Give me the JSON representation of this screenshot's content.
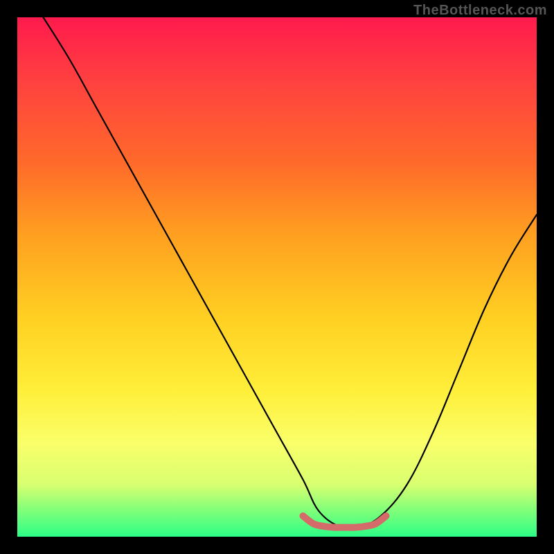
{
  "watermark": "TheBottleneck.com",
  "colors": {
    "frame": "#000000",
    "gradient_stops": [
      {
        "pct": 0,
        "color": "#ff1a4d"
      },
      {
        "pct": 12,
        "color": "#ff4040"
      },
      {
        "pct": 28,
        "color": "#ff6a2a"
      },
      {
        "pct": 42,
        "color": "#ffa020"
      },
      {
        "pct": 58,
        "color": "#ffd022"
      },
      {
        "pct": 72,
        "color": "#ffef3a"
      },
      {
        "pct": 82,
        "color": "#faff6a"
      },
      {
        "pct": 90,
        "color": "#d8ff70"
      },
      {
        "pct": 95,
        "color": "#7fff7a"
      },
      {
        "pct": 100,
        "color": "#2cff86"
      }
    ],
    "curve_main": "#000000",
    "curve_accent": "#d46a6a"
  },
  "chart_data": {
    "type": "line",
    "title": "",
    "xlabel": "",
    "ylabel": "",
    "xlim": [
      0,
      100
    ],
    "ylim": [
      0,
      100
    ],
    "series": [
      {
        "name": "main-curve",
        "x": [
          5,
          10,
          15,
          20,
          25,
          30,
          35,
          40,
          45,
          50,
          55,
          58,
          62,
          66,
          70,
          75,
          80,
          85,
          90,
          95,
          100
        ],
        "values": [
          100,
          92,
          83,
          74,
          65,
          56,
          47,
          38,
          29,
          20,
          11,
          5,
          2,
          2,
          4,
          10,
          20,
          32,
          44,
          54,
          62
        ]
      },
      {
        "name": "valley-accent",
        "x": [
          55,
          57,
          59,
          61,
          63,
          65,
          67,
          69,
          71
        ],
        "values": [
          4,
          2.5,
          2,
          1.8,
          1.8,
          1.8,
          2,
          2.5,
          4
        ]
      }
    ]
  }
}
